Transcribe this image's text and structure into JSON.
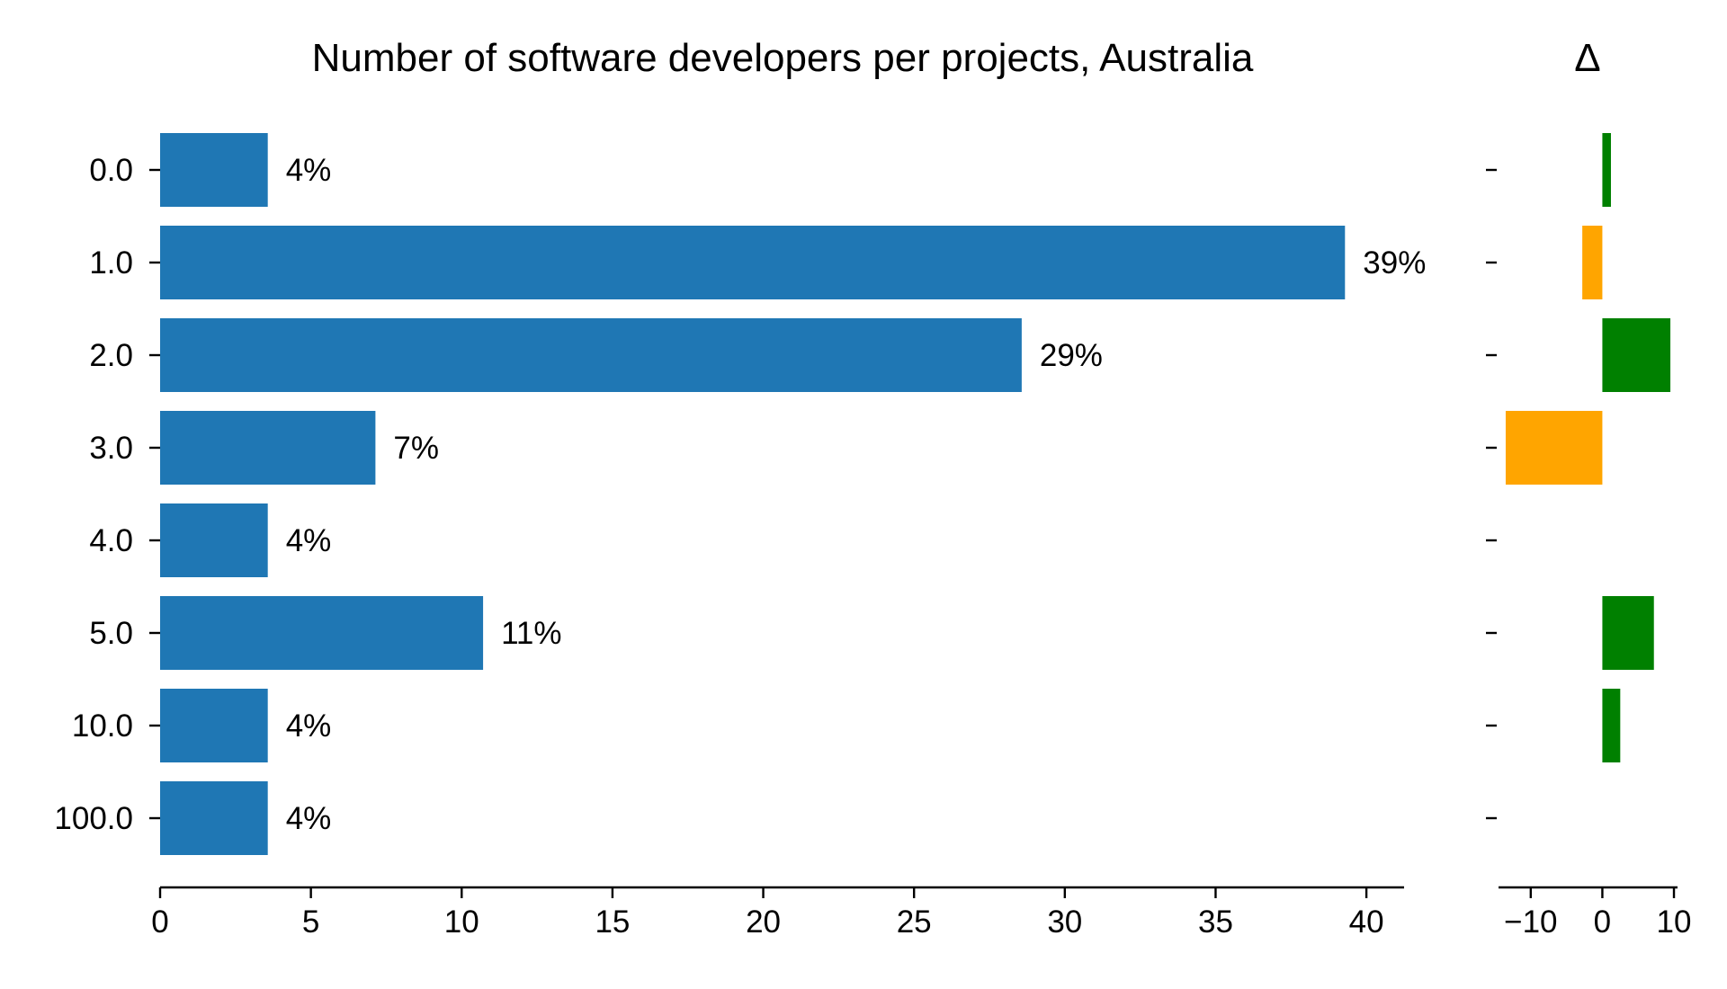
{
  "chart_data": [
    {
      "type": "bar",
      "orientation": "horizontal",
      "title": "Number of software developers per projects, Australia",
      "xlabel": "",
      "ylabel": "",
      "categories": [
        "0.0",
        "1.0",
        "2.0",
        "3.0",
        "4.0",
        "5.0",
        "10.0",
        "100.0"
      ],
      "values": [
        3.57,
        39.29,
        28.57,
        7.14,
        3.57,
        10.71,
        3.57,
        3.57
      ],
      "data_labels": [
        "4%",
        "39%",
        "29%",
        "7%",
        "4%",
        "11%",
        "4%",
        "4%"
      ],
      "xlim": [
        0,
        41.25
      ],
      "xticks": [
        0,
        5,
        10,
        15,
        20,
        25,
        30,
        35,
        40
      ],
      "xtick_labels": [
        "0",
        "5",
        "10",
        "15",
        "20",
        "25",
        "30",
        "35",
        "40"
      ],
      "bar_color": "#1f77b4",
      "grid": false
    },
    {
      "type": "bar",
      "orientation": "horizontal",
      "title": "Δ",
      "xlabel": "",
      "ylabel": "",
      "categories": [
        "0.0",
        "1.0",
        "2.0",
        "3.0",
        "4.0",
        "5.0",
        "10.0",
        "100.0"
      ],
      "values": [
        1.2,
        -2.8,
        9.5,
        -13.5,
        0,
        7.2,
        2.5,
        0
      ],
      "xlim": [
        -14.5,
        10.5
      ],
      "xticks": [
        -10,
        0,
        10
      ],
      "xtick_labels": [
        "−10",
        "0",
        "10"
      ],
      "positive_color": "#008000",
      "negative_color": "#ffa500",
      "grid": false
    }
  ]
}
